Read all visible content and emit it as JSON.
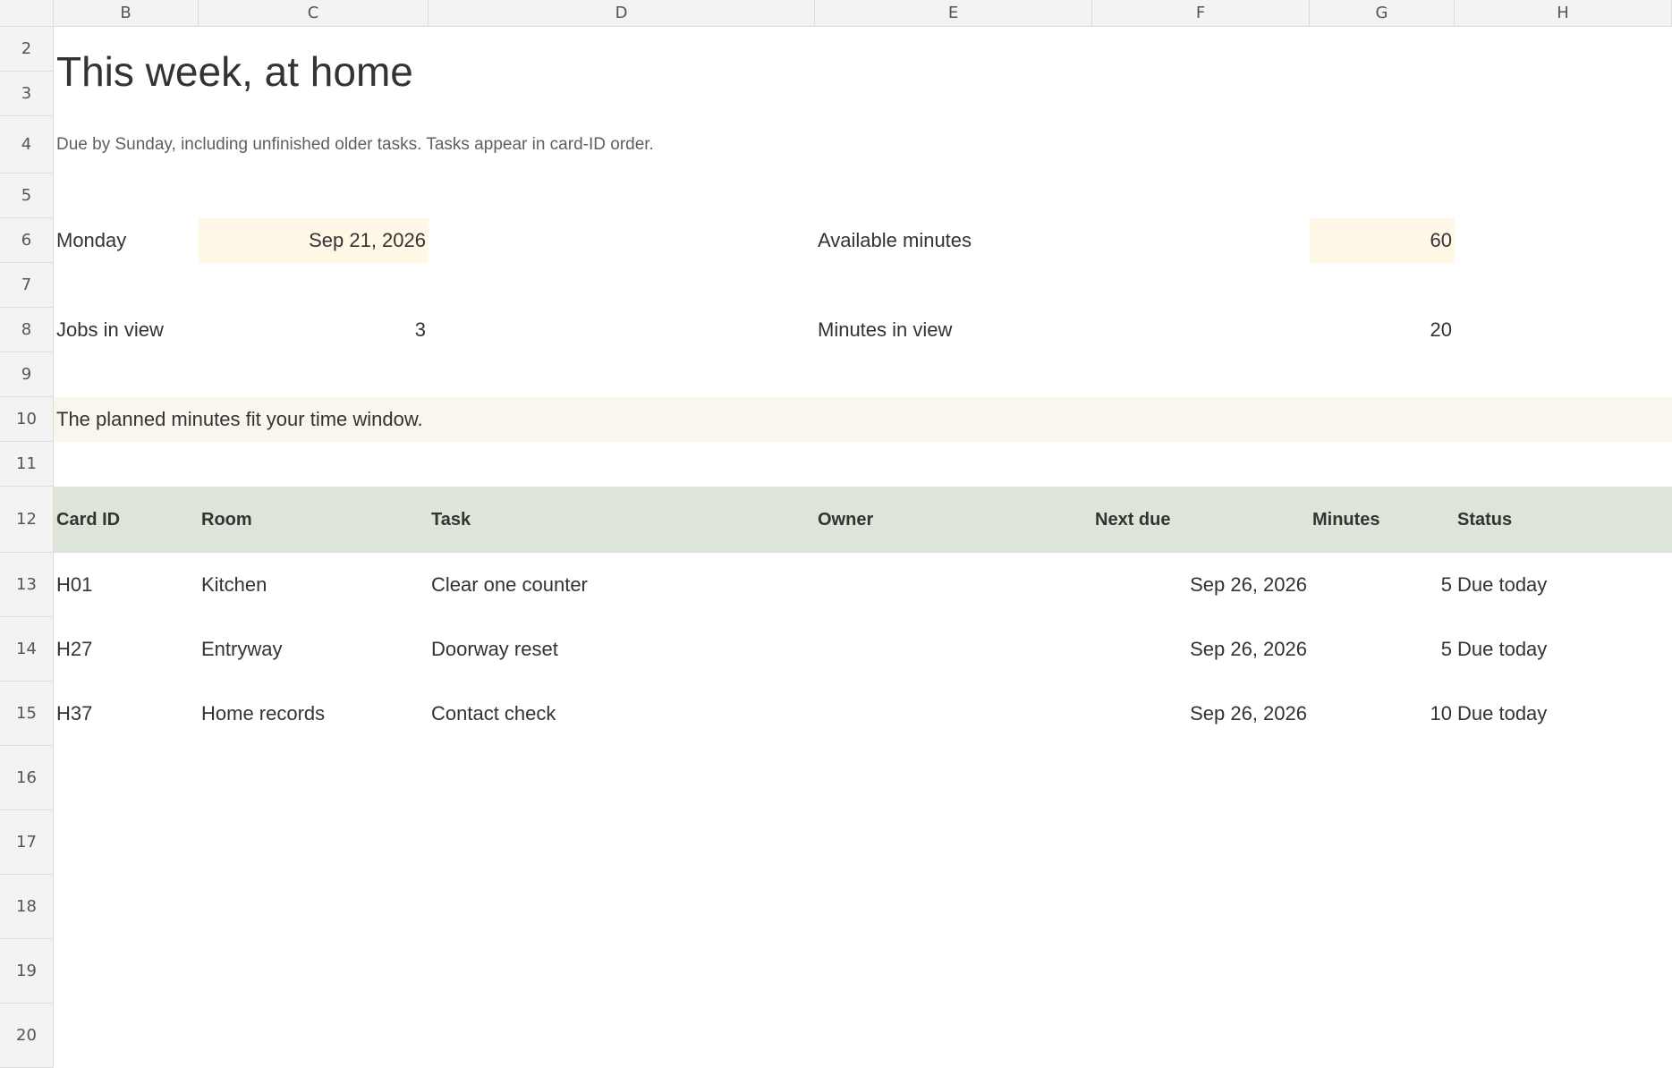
{
  "columns": [
    "B",
    "C",
    "D",
    "E",
    "F",
    "G",
    "H"
  ],
  "rows": [
    "2",
    "3",
    "4",
    "5",
    "6",
    "7",
    "8",
    "9",
    "10",
    "11",
    "12",
    "13",
    "14",
    "15",
    "16",
    "17",
    "18",
    "19",
    "20"
  ],
  "sheet": {
    "title": "This week, at home",
    "subtitle": "Due by Sunday, including unfinished older tasks. Tasks appear in card-ID order.",
    "monday_label": "Monday",
    "monday_value": "Sep 21, 2026",
    "available_label": "Available minutes",
    "available_value": "60",
    "jobs_label": "Jobs in view",
    "jobs_value": "3",
    "minutes_label": "Minutes in view",
    "minutes_value": "20",
    "message": "The planned minutes fit your time window."
  },
  "table": {
    "headers": [
      "Card ID",
      "Room",
      "Task",
      "Owner",
      "Next due",
      "Minutes",
      "Status"
    ],
    "rows": [
      {
        "card_id": "H01",
        "room": "Kitchen",
        "task": "Clear one counter",
        "owner": "",
        "next_due": "Sep 26, 2026",
        "minutes": "5",
        "status": "Due today"
      },
      {
        "card_id": "H27",
        "room": "Entryway",
        "task": "Doorway reset",
        "owner": "",
        "next_due": "Sep 26, 2026",
        "minutes": "5",
        "status": "Due today"
      },
      {
        "card_id": "H37",
        "room": "Home records",
        "task": "Contact check",
        "owner": "",
        "next_due": "Sep 26, 2026",
        "minutes": "10",
        "status": "Due today"
      }
    ]
  },
  "colors": {
    "input_fill": "#fff8e6",
    "message_fill": "#f9f6ee",
    "header_fill": "#dde5d8",
    "grid_header": "#f3f3f3"
  }
}
